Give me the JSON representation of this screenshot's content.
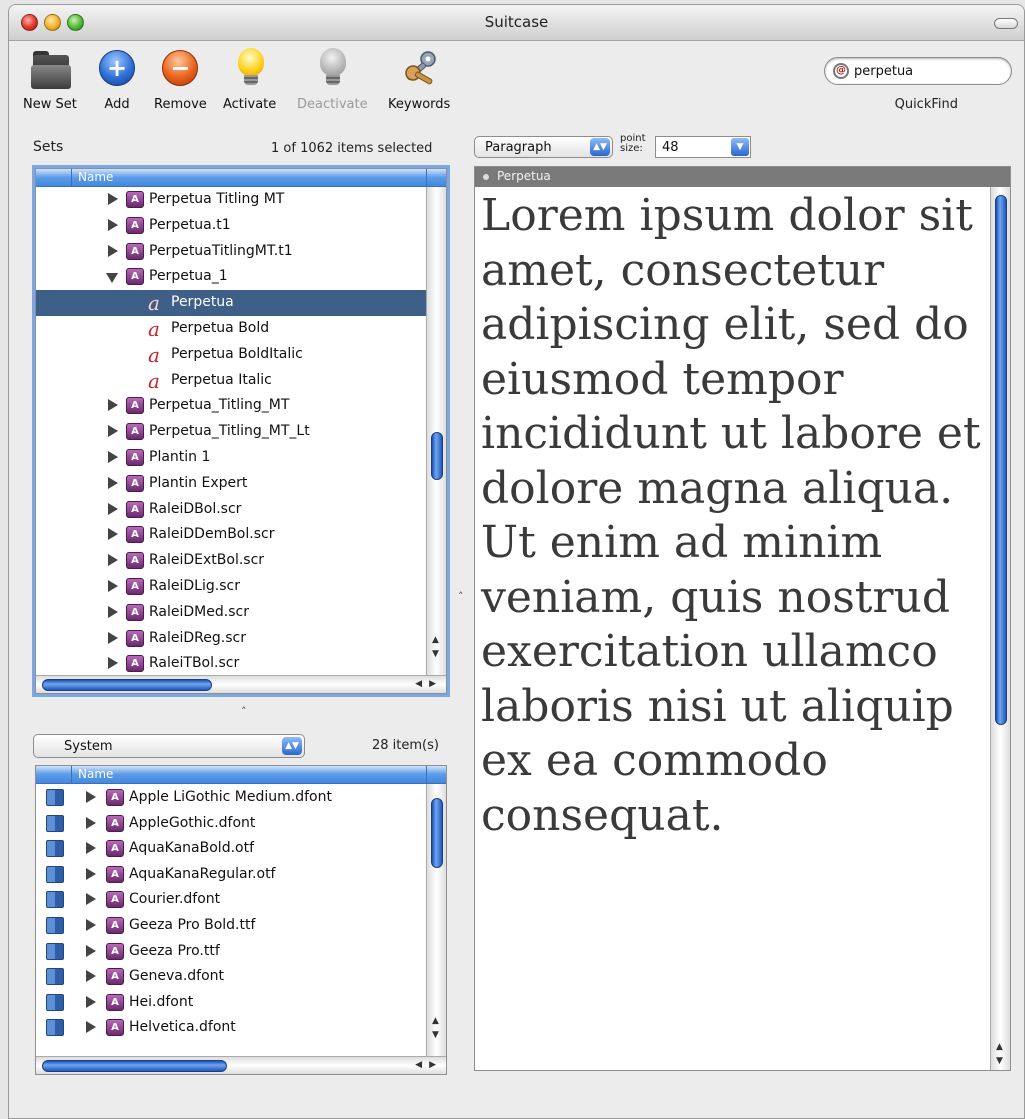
{
  "window": {
    "title": "Suitcase"
  },
  "toolbar": {
    "items": [
      {
        "label": "New Set",
        "icon": "folder-icon",
        "enabled": true
      },
      {
        "label": "Add",
        "icon": "plus-circle-icon",
        "enabled": true
      },
      {
        "label": "Remove",
        "icon": "minus-circle-icon",
        "enabled": true
      },
      {
        "label": "Activate",
        "icon": "lightbulb-on-icon",
        "enabled": true
      },
      {
        "label": "Deactivate",
        "icon": "lightbulb-off-icon",
        "enabled": false
      },
      {
        "label": "Keywords",
        "icon": "keys-icon",
        "enabled": true
      }
    ],
    "quickfind": {
      "value": "perpetua",
      "label": "QuickFind"
    }
  },
  "sets": {
    "label": "Sets",
    "count_text": "1 of 1062 items selected",
    "column_name": "Name",
    "rows": [
      {
        "text": "Perpetua Titling MT",
        "kind": "set",
        "expanded": false,
        "selected": false
      },
      {
        "text": "Perpetua.t1",
        "kind": "set",
        "expanded": false,
        "selected": false
      },
      {
        "text": "PerpetuaTitlingMT.t1",
        "kind": "set",
        "expanded": false,
        "selected": false
      },
      {
        "text": "Perpetua_1",
        "kind": "set",
        "expanded": true,
        "selected": false
      },
      {
        "text": "Perpetua",
        "kind": "font",
        "selected": true
      },
      {
        "text": "Perpetua Bold",
        "kind": "font",
        "selected": false
      },
      {
        "text": "Perpetua BoldItalic",
        "kind": "font",
        "selected": false
      },
      {
        "text": "Perpetua Italic",
        "kind": "font",
        "selected": false
      },
      {
        "text": "Perpetua_Titling_MT",
        "kind": "set",
        "expanded": false,
        "selected": false
      },
      {
        "text": "Perpetua_Titling_MT_Lt",
        "kind": "set",
        "expanded": false,
        "selected": false
      },
      {
        "text": "Plantin 1",
        "kind": "set",
        "expanded": false,
        "selected": false
      },
      {
        "text": "Plantin Expert",
        "kind": "set",
        "expanded": false,
        "selected": false
      },
      {
        "text": "RaleiDBol.scr",
        "kind": "set",
        "expanded": false,
        "selected": false
      },
      {
        "text": "RaleiDDemBol.scr",
        "kind": "set",
        "expanded": false,
        "selected": false
      },
      {
        "text": "RaleiDExtBol.scr",
        "kind": "set",
        "expanded": false,
        "selected": false
      },
      {
        "text": "RaleiDLig.scr",
        "kind": "set",
        "expanded": false,
        "selected": false
      },
      {
        "text": "RaleiDMed.scr",
        "kind": "set",
        "expanded": false,
        "selected": false
      },
      {
        "text": "RaleiDReg.scr",
        "kind": "set",
        "expanded": false,
        "selected": false
      },
      {
        "text": "RaleiTBol.scr",
        "kind": "set",
        "expanded": false,
        "selected": false
      }
    ]
  },
  "system": {
    "popup_value": "System",
    "count_text": "28 item(s)",
    "column_name": "Name",
    "rows": [
      {
        "text": "Apple LiGothic Medium.dfont"
      },
      {
        "text": "AppleGothic.dfont"
      },
      {
        "text": "AquaKanaBold.otf"
      },
      {
        "text": "AquaKanaRegular.otf"
      },
      {
        "text": "Courier.dfont"
      },
      {
        "text": "Geeza Pro Bold.ttf"
      },
      {
        "text": "Geeza Pro.ttf"
      },
      {
        "text": "Geneva.dfont"
      },
      {
        "text": "Hei.dfont"
      },
      {
        "text": "Helvetica.dfont"
      }
    ]
  },
  "preview": {
    "mode": "Paragraph",
    "point_label": "point size:",
    "point_size": "48",
    "font_name": "Perpetua",
    "sample_text": "Lorem ipsum dolor sit amet, consectetur adipiscing elit, sed do eiusmod tempor incididunt ut labore et dolore magna aliqua. Ut enim ad minim veniam, quis nostrud exercitation ullamco laboris nisi ut aliquip ex ea commodo consequat."
  },
  "colors": {
    "selection": "#3d5f88",
    "accent": "#4489e0",
    "font_icon": "#c7262d"
  }
}
